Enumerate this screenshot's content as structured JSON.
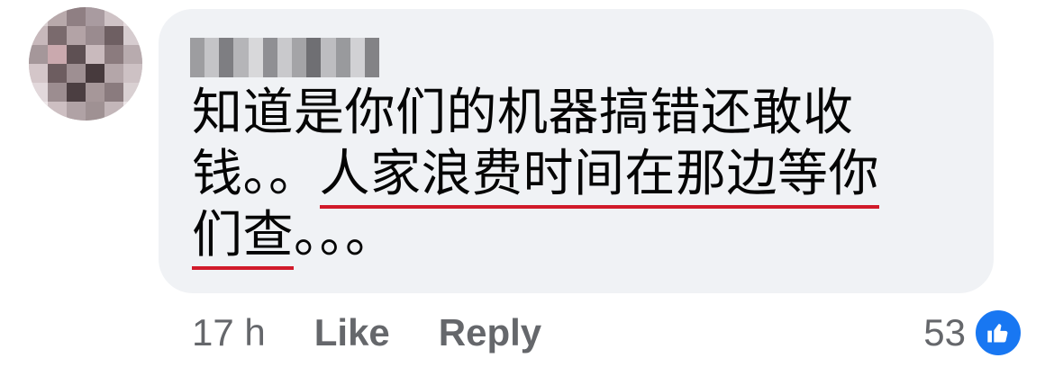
{
  "comment": {
    "author": "",
    "text_line1": "知道是你们的机器搞错还敢收",
    "text_line2_pre": "钱。。",
    "text_line2_highlight": "人家浪费时间在那边等你",
    "text_line3_highlight": "们查",
    "text_line3_post": "。。。",
    "timestamp": "17 h",
    "like_label": "Like",
    "reply_label": "Reply",
    "reaction_count": "53"
  },
  "colors": {
    "bubble": "#f0f2f5",
    "text": "#050505",
    "meta": "#65676b",
    "underline": "#d11a2a",
    "like_badge": "#1877f2"
  }
}
